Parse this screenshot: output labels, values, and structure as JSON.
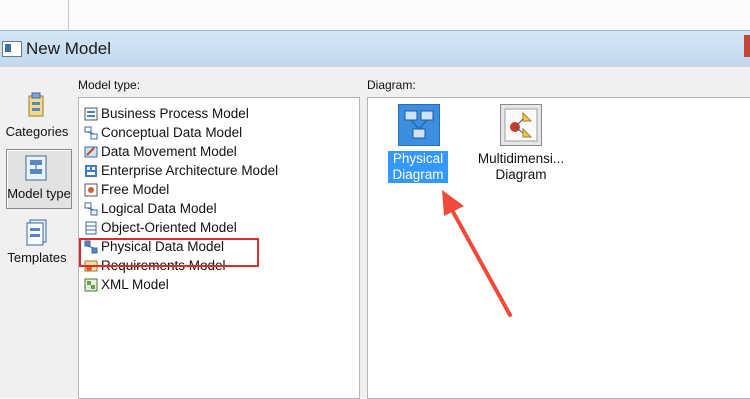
{
  "window": {
    "title": "New Model"
  },
  "labels": {
    "model_type": "Model type:",
    "diagram": "Diagram:"
  },
  "categories": [
    {
      "label": "Categories"
    },
    {
      "label": "Model type",
      "selected": true
    },
    {
      "label": "Templates"
    }
  ],
  "model_types": [
    {
      "label": "Business Process Model",
      "icon": "business-process-icon"
    },
    {
      "label": "Conceptual Data Model",
      "icon": "conceptual-data-icon"
    },
    {
      "label": "Data Movement Model",
      "icon": "data-movement-icon"
    },
    {
      "label": "Enterprise Architecture Model",
      "icon": "enterprise-architecture-icon"
    },
    {
      "label": "Free Model",
      "icon": "free-model-icon"
    },
    {
      "label": "Logical Data Model",
      "icon": "logical-data-icon"
    },
    {
      "label": "Object-Oriented Model",
      "icon": "object-oriented-icon"
    },
    {
      "label": "Physical Data Model",
      "icon": "physical-data-icon",
      "highlighted": true
    },
    {
      "label": "Requirements Model",
      "icon": "requirements-icon"
    },
    {
      "label": "XML Model",
      "icon": "xml-model-icon"
    }
  ],
  "diagrams": [
    {
      "label_line1": "Physical",
      "label_line2": "Diagram",
      "selected": true,
      "icon": "physical-diagram-icon"
    },
    {
      "label_line1": "Multidimensi...",
      "label_line2": "Diagram",
      "selected": false,
      "icon": "multidimensional-diagram-icon"
    }
  ],
  "colors": {
    "highlight": "#e02a2a",
    "selection": "#3399ff",
    "arrow": "#f04a3a"
  }
}
